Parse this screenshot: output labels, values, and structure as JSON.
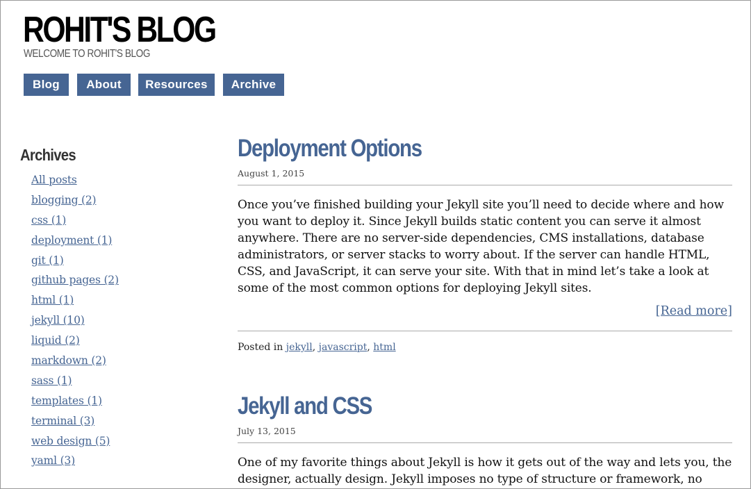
{
  "site": {
    "title": "ROHIT'S BLOG",
    "tagline": "WELCOME TO ROHIT'S BLOG"
  },
  "nav": [
    {
      "label": "Blog"
    },
    {
      "label": "About"
    },
    {
      "label": "Resources"
    },
    {
      "label": "Archive"
    }
  ],
  "sidebar": {
    "title": "Archives",
    "items": [
      {
        "label": "All posts"
      },
      {
        "label": "blogging (2)"
      },
      {
        "label": "css (1)"
      },
      {
        "label": "deployment (1)"
      },
      {
        "label": "git (1)"
      },
      {
        "label": "github pages (2)"
      },
      {
        "label": "html (1)"
      },
      {
        "label": "jekyll (10)"
      },
      {
        "label": "liquid (2)"
      },
      {
        "label": "markdown (2)"
      },
      {
        "label": "sass (1)"
      },
      {
        "label": "templates (1)"
      },
      {
        "label": "terminal (3)"
      },
      {
        "label": "web design (5)"
      },
      {
        "label": "yaml (3)"
      }
    ]
  },
  "posts": [
    {
      "title": "Deployment Options",
      "date": "August 1, 2015",
      "excerpt": "Once you’ve finished building your Jekyll site you’ll need to decide where and how you want to deploy it. Since Jekyll builds static content you can serve it almost anywhere. There are no server-side dependencies, CMS installations, database administrators, or server stacks to worry about. If the server can handle HTML, CSS, and JavaScript, it can serve your site. With that in mind let’s take a look at some of the most common options for deploying Jekyll sites.",
      "read_more": "[Read more]",
      "posted_in": "Posted in",
      "tags": [
        "jekyll",
        "javascript",
        "html"
      ]
    },
    {
      "title": "Jekyll and CSS",
      "date": "July 13, 2015",
      "excerpt": "One of my favorite things about Jekyll is how it gets out of the way and lets you, the designer, actually design. Jekyll imposes no type of structure or framework, no"
    }
  ],
  "colors": {
    "accent": "#466593",
    "title": "#000000",
    "tagline": "#555555",
    "rule": "#aaaaaa"
  }
}
